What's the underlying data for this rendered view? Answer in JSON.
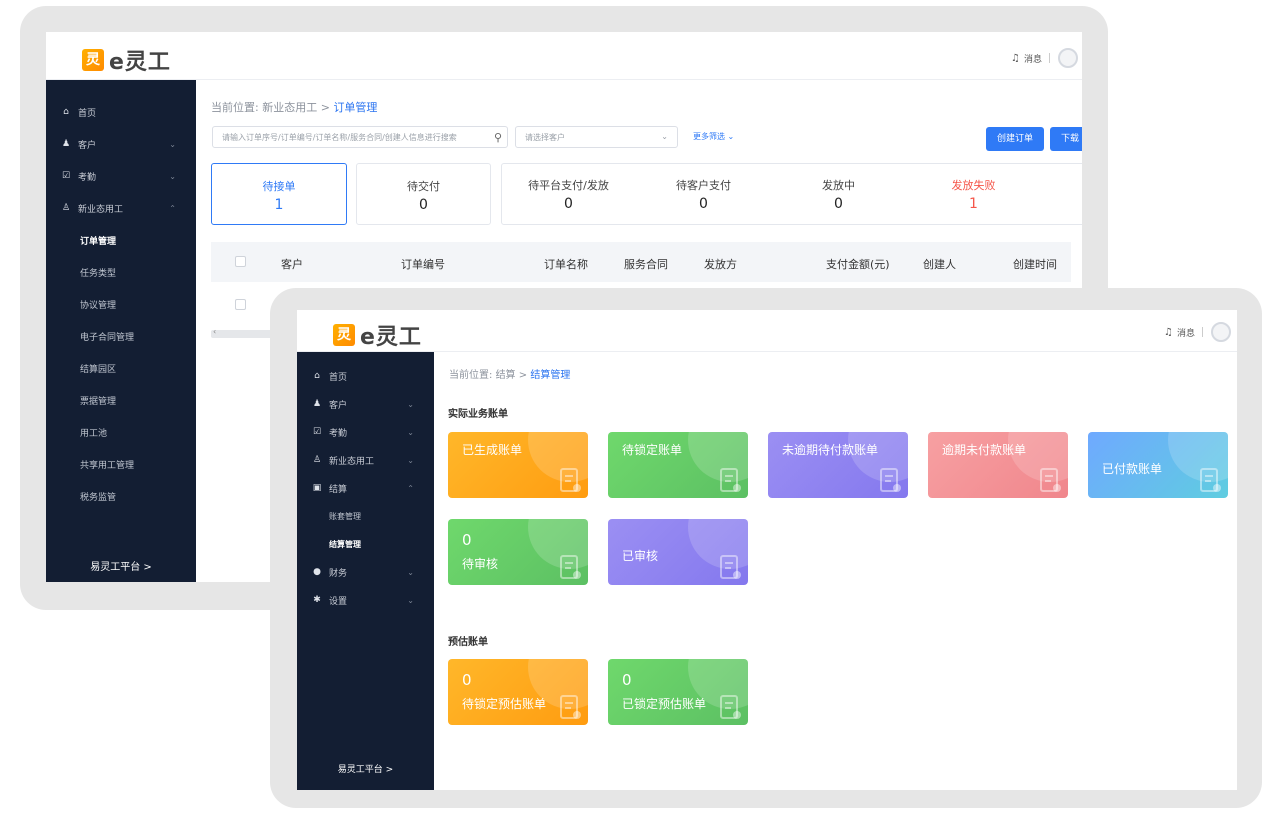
{
  "brand": {
    "mark": "灵",
    "name": "e灵工"
  },
  "colors": {
    "primary": "#2f7af6",
    "sidebar": "#131e33",
    "danger": "#f5564a"
  },
  "back_screen": {
    "top": {
      "message": "消息"
    },
    "sidebar": {
      "items": [
        {
          "icon": "home-icon",
          "glyph": "⌂",
          "label": "首页"
        },
        {
          "icon": "users-icon",
          "glyph": "♟",
          "label": "客户"
        },
        {
          "icon": "calendar-check-icon",
          "glyph": "☑",
          "label": "考勤"
        },
        {
          "icon": "user-icon",
          "glyph": "♙",
          "label": "新业态用工"
        }
      ],
      "sub_items": [
        "订单管理",
        "任务类型",
        "协议管理",
        "电子合同管理",
        "结算园区",
        "票据管理",
        "用工池",
        "共享用工管理",
        "税务监管"
      ],
      "platform": "易灵工平台 >"
    },
    "breadcrumb": {
      "prefix": "当前位置:",
      "parent": "新业态用工",
      "separator": ">",
      "current": "订单管理"
    },
    "filters": {
      "search_placeholder": "请输入订单序号/订单编号/订单名称/服务合同/创建人信息进行搜索",
      "customer_placeholder": "请选择客户",
      "more": "更多筛选"
    },
    "buttons": {
      "create": "创建订单",
      "download": "下载"
    },
    "tabs": [
      {
        "label": "待接单",
        "count": "1"
      },
      {
        "label": "待交付",
        "count": "0"
      },
      {
        "label": "待平台支付/发放",
        "count": "0"
      },
      {
        "label": "待客户支付",
        "count": "0"
      },
      {
        "label": "发放中",
        "count": "0"
      },
      {
        "label": "发放失败",
        "count": "1"
      }
    ],
    "columns": [
      "客户",
      "订单编号",
      "订单名称",
      "服务合同",
      "发放方",
      "支付金额(元)",
      "创建人",
      "创建时间"
    ]
  },
  "front_screen": {
    "top": {
      "message": "消息"
    },
    "sidebar": {
      "items": [
        {
          "icon": "home-icon",
          "glyph": "⌂",
          "label": "首页"
        },
        {
          "icon": "users-icon",
          "glyph": "♟",
          "label": "客户"
        },
        {
          "icon": "calendar-check-icon",
          "glyph": "☑",
          "label": "考勤"
        },
        {
          "icon": "user-icon",
          "glyph": "♙",
          "label": "新业态用工"
        },
        {
          "icon": "ledger-icon",
          "glyph": "▣",
          "label": "结算"
        }
      ],
      "sub_items": [
        "账套管理",
        "结算管理"
      ],
      "items_after": [
        {
          "icon": "finance-icon",
          "glyph": "●",
          "label": "财务"
        },
        {
          "icon": "gear-icon",
          "glyph": "✱",
          "label": "设置"
        }
      ],
      "platform": "易灵工平台 >"
    },
    "breadcrumb": {
      "prefix": "当前位置:",
      "parent": "结算",
      "separator": ">",
      "current": "结算管理"
    },
    "actual_section": {
      "title": "实际业务账单",
      "cards": [
        {
          "label": "已生成账单",
          "count": ""
        },
        {
          "label": "待锁定账单",
          "count": ""
        },
        {
          "label": "未逾期待付款账单",
          "count": ""
        },
        {
          "label": "逾期未付款账单",
          "count": ""
        },
        {
          "label": "已付款账单",
          "count": ""
        },
        {
          "label": "待审核",
          "count": "0"
        },
        {
          "label": "已审核",
          "count": ""
        }
      ]
    },
    "estimate_section": {
      "title": "预估账单",
      "cards": [
        {
          "label": "待锁定预估账单",
          "count": "0"
        },
        {
          "label": "已锁定预估账单",
          "count": "0"
        }
      ]
    }
  }
}
